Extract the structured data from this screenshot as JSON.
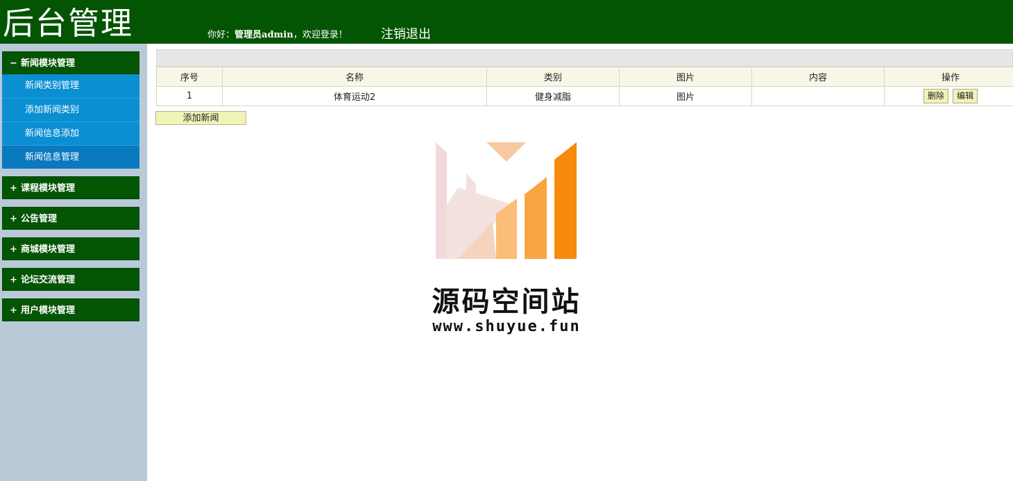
{
  "header": {
    "title": "后台管理",
    "greeting_prefix": "你好：",
    "user": "管理员admin",
    "greeting_suffix": "，欢迎登录！",
    "logout": "注销退出"
  },
  "sidebar": {
    "groups": [
      {
        "sign": "−",
        "label": "新闻模块管理",
        "expanded": true,
        "items": [
          {
            "label": "新闻类别管理"
          },
          {
            "label": "添加新闻类别"
          },
          {
            "label": "新闻信息添加"
          },
          {
            "label": "新闻信息管理"
          }
        ]
      },
      {
        "sign": "+",
        "label": "课程模块管理"
      },
      {
        "sign": "+",
        "label": "公告管理"
      },
      {
        "sign": "+",
        "label": "商城模块管理"
      },
      {
        "sign": "+",
        "label": "论坛交流管理"
      },
      {
        "sign": "+",
        "label": "用户模块管理"
      }
    ]
  },
  "table": {
    "columns": [
      "序号",
      "名称",
      "类别",
      "图片",
      "内容",
      "操作"
    ],
    "rows": [
      {
        "index": "1",
        "name": "体育运动2",
        "category": "健身减脂",
        "image": "图片",
        "content": ""
      }
    ],
    "delete_label": "删除",
    "edit_label": "编辑"
  },
  "add_button": "添加新闻",
  "watermark": {
    "text": "源码空间站",
    "url": "www.shuyue.fun"
  },
  "colors": {
    "header_bg": "#035403",
    "sidebar_bg": "#b9c9d8",
    "submenu_bg": "#0a8fd3",
    "button_bg": "#f1f3b7"
  }
}
